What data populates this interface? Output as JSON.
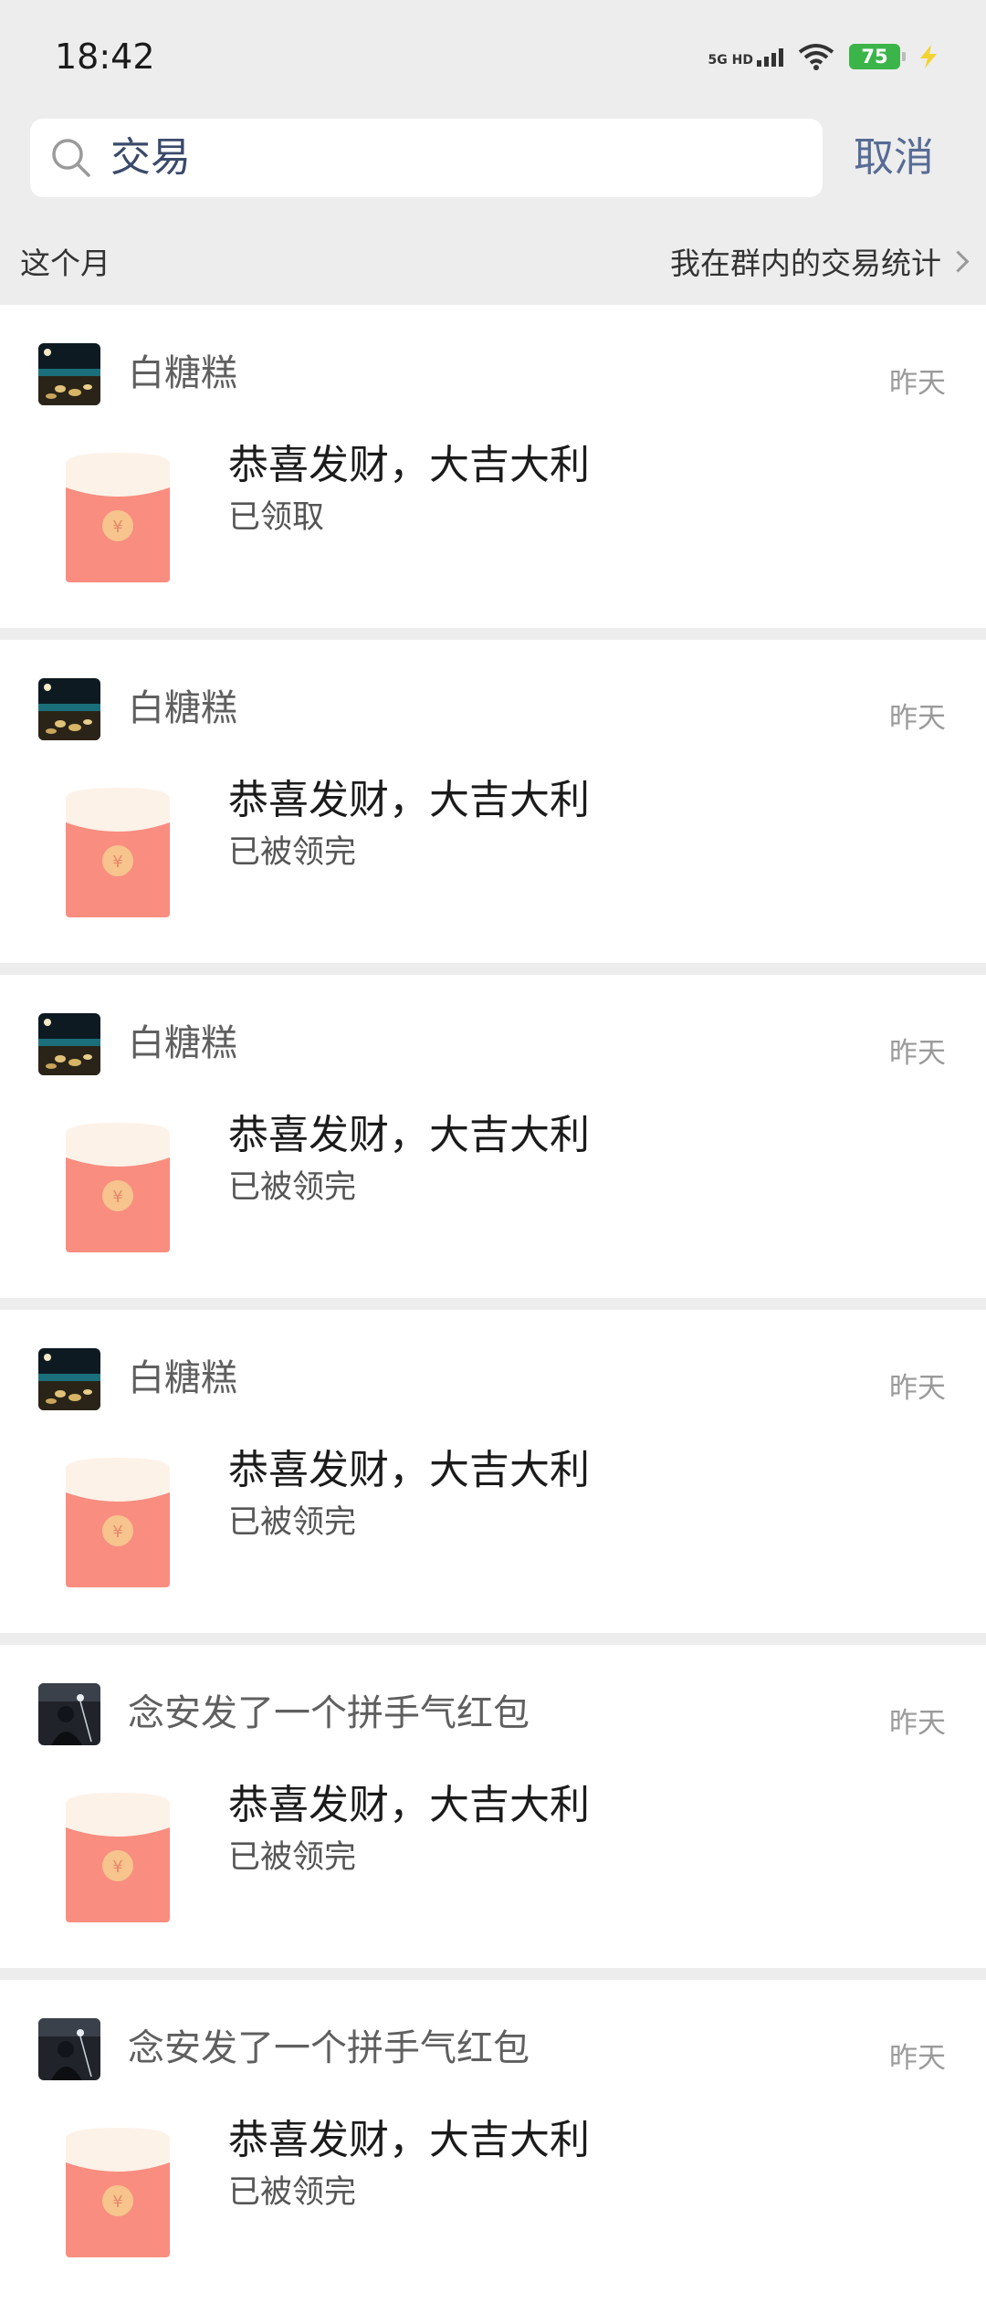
{
  "status_bar": {
    "time": "18:42",
    "network_label": "5G HD",
    "battery": "75",
    "icons": [
      "signal-icon",
      "wifi-icon",
      "battery-icon",
      "charging-icon"
    ]
  },
  "search": {
    "query": "交易",
    "cancel_label": "取消"
  },
  "filter": {
    "period": "这个月",
    "stats_link": "我在群内的交易统计"
  },
  "colors": {
    "envelope_red": "#f98d80",
    "envelope_flap": "#fdf2e8",
    "coin": "#f6c48c",
    "link_blue": "#576b95"
  },
  "transactions": [
    {
      "sender": "白糖糕",
      "date": "昨天",
      "blessing": "恭喜发财，大吉大利",
      "status": "已领取",
      "avatar": "night-sea-avatar"
    },
    {
      "sender": "白糖糕",
      "date": "昨天",
      "blessing": "恭喜发财，大吉大利",
      "status": "已被领完",
      "avatar": "night-sea-avatar"
    },
    {
      "sender": "白糖糕",
      "date": "昨天",
      "blessing": "恭喜发财，大吉大利",
      "status": "已被领完",
      "avatar": "night-sea-avatar"
    },
    {
      "sender": "白糖糕",
      "date": "昨天",
      "blessing": "恭喜发财，大吉大利",
      "status": "已被领完",
      "avatar": "night-sea-avatar"
    },
    {
      "sender": "念安发了一个拼手气红包",
      "date": "昨天",
      "blessing": "恭喜发财，大吉大利",
      "status": "已被领完",
      "avatar": "dark-figure-avatar"
    },
    {
      "sender": "念安发了一个拼手气红包",
      "date": "昨天",
      "blessing": "恭喜发财，大吉大利",
      "status": "已被领完",
      "avatar": "dark-figure-avatar"
    }
  ]
}
